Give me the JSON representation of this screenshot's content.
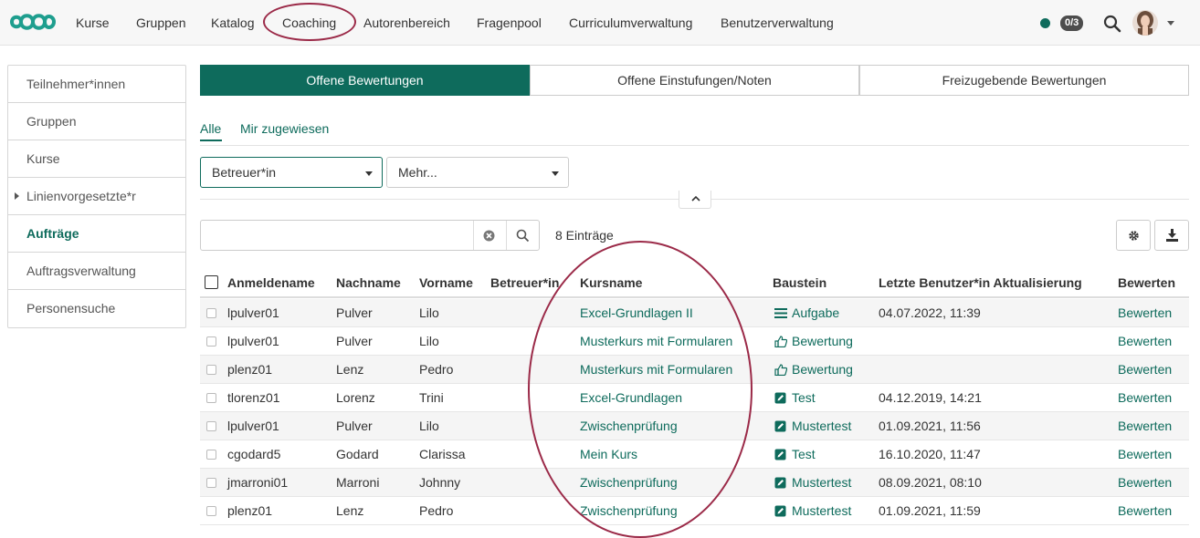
{
  "nav": {
    "items": [
      "Kurse",
      "Gruppen",
      "Katalog",
      "Coaching",
      "Autorenbereich",
      "Fragenpool",
      "Curriculumverwaltung",
      "Benutzerverwaltung"
    ],
    "badge": "0/3",
    "accent": "#0e6b5c",
    "annotation_color": "#9b2a48"
  },
  "sidebar": {
    "items": [
      "Teilnehmer*innen",
      "Gruppen",
      "Kurse",
      "Linienvorgesetzte*r",
      "Aufträge",
      "Auftragsverwaltung",
      "Personensuche"
    ],
    "active": "Aufträge"
  },
  "tabs": [
    "Offene Bewertungen",
    "Offene Einstufungen/Noten",
    "Freizugebende Bewertungen"
  ],
  "subtabs": [
    "Alle",
    "Mir zugewiesen"
  ],
  "filters": {
    "betreuer": "Betreuer*in",
    "mehr": "Mehr..."
  },
  "search": {
    "value": "",
    "entries": "8 Einträge"
  },
  "table": {
    "headers": [
      "Anmeldename",
      "Nachname",
      "Vorname",
      "Betreuer*in",
      "Kursname",
      "Baustein",
      "Letzte Benutzer*in Aktualisierung",
      "Bewerten"
    ],
    "rows": [
      {
        "login": "lpulver01",
        "last": "Pulver",
        "first": "Lilo",
        "coach": "",
        "course": "Excel-Grundlagen II",
        "icon": "task-icon",
        "block": "Aufgabe",
        "updated": "04.07.2022, 11:39",
        "action": "Bewerten"
      },
      {
        "login": "lpulver01",
        "last": "Pulver",
        "first": "Lilo",
        "coach": "",
        "course": "Musterkurs mit Formularen",
        "icon": "thumbs-up-icon",
        "block": "Bewertung",
        "updated": "",
        "action": "Bewerten"
      },
      {
        "login": "plenz01",
        "last": "Lenz",
        "first": "Pedro",
        "coach": "",
        "course": "Musterkurs mit Formularen",
        "icon": "thumbs-up-icon",
        "block": "Bewertung",
        "updated": "",
        "action": "Bewerten"
      },
      {
        "login": "tlorenz01",
        "last": "Lorenz",
        "first": "Trini",
        "coach": "",
        "course": "Excel-Grundlagen",
        "icon": "test-icon",
        "block": "Test",
        "updated": "04.12.2019, 14:21",
        "action": "Bewerten"
      },
      {
        "login": "lpulver01",
        "last": "Pulver",
        "first": "Lilo",
        "coach": "",
        "course": "Zwischenprüfung",
        "icon": "test-icon",
        "block": "Mustertest",
        "updated": "01.09.2021, 11:56",
        "action": "Bewerten"
      },
      {
        "login": "cgodard5",
        "last": "Godard",
        "first": "Clarissa",
        "coach": "",
        "course": "Mein Kurs",
        "icon": "test-icon",
        "block": "Test",
        "updated": "16.10.2020, 11:47",
        "action": "Bewerten"
      },
      {
        "login": "jmarroni01",
        "last": "Marroni",
        "first": "Johnny",
        "coach": "",
        "course": "Zwischenprüfung",
        "icon": "test-icon",
        "block": "Mustertest",
        "updated": "08.09.2021, 08:10",
        "action": "Bewerten"
      },
      {
        "login": "plenz01",
        "last": "Lenz",
        "first": "Pedro",
        "coach": "",
        "course": "Zwischenprüfung",
        "icon": "test-icon",
        "block": "Mustertest",
        "updated": "01.09.2021, 11:59",
        "action": "Bewerten"
      }
    ]
  }
}
